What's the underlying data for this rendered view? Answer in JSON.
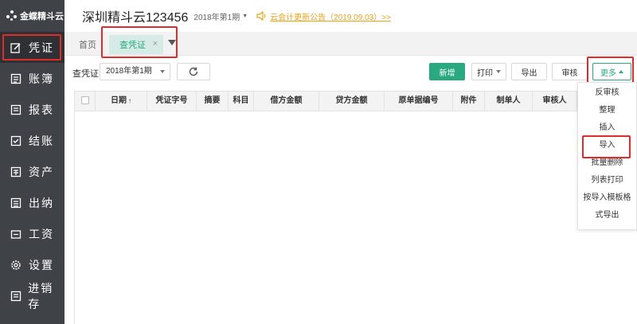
{
  "sidebar": {
    "logo": "金蝶精斗云",
    "items": [
      {
        "label": "凭证",
        "icon": "edit-icon"
      },
      {
        "label": "账簿",
        "icon": "book-icon"
      },
      {
        "label": "报表",
        "icon": "report-icon"
      },
      {
        "label": "结账",
        "icon": "checkbox-icon"
      },
      {
        "label": "资产",
        "icon": "asset-icon"
      },
      {
        "label": "出纳",
        "icon": "cashier-icon"
      },
      {
        "label": "工资",
        "icon": "wallet-icon"
      },
      {
        "label": "设置",
        "icon": "gear-icon"
      },
      {
        "label": "进销存",
        "icon": "inventory-icon"
      }
    ]
  },
  "header": {
    "company": "深圳精斗云123456",
    "period": "2018年第1期",
    "notice": "云会计更新公告（2019.09.03）>>"
  },
  "tabs": {
    "home": "首页",
    "active": "查凭证",
    "close": "×"
  },
  "toolbar": {
    "label": "查凭证",
    "period_value": "2018年第1期",
    "new_label": "新增",
    "print_label": "打印",
    "export_label": "导出",
    "audit_label": "审核",
    "more_label": "更多"
  },
  "table": {
    "columns": [
      "日期",
      "凭证字号",
      "摘要",
      "科目",
      "借方金额",
      "贷方金额",
      "原单据编号",
      "附件",
      "制单人",
      "审核人"
    ],
    "sort_indicator": "↑"
  },
  "more_menu": {
    "items": [
      "反审核",
      "整理",
      "插入",
      "导入",
      "批量删除",
      "列表打印",
      "按导入模板格",
      "式导出"
    ]
  },
  "colors": {
    "sidebar_bg": "#3f4246",
    "accent": "#2aa981",
    "notice": "#e8a317",
    "highlight": "#e02b2b"
  }
}
